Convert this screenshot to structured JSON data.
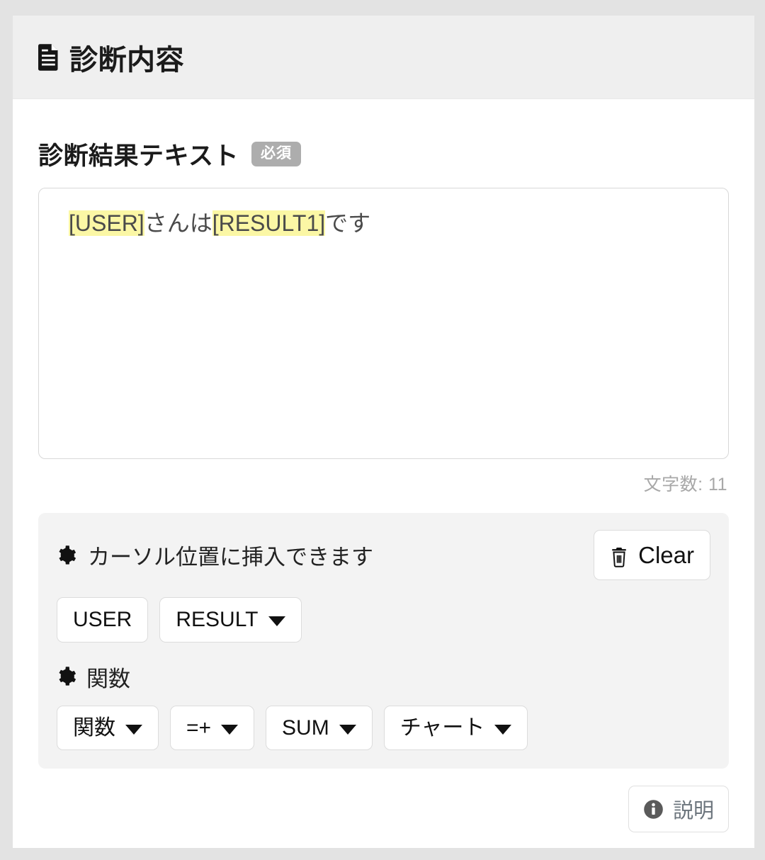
{
  "header": {
    "icon": "document-icon",
    "title": "診断内容"
  },
  "field": {
    "label": "診断結果テキスト",
    "required_badge": "必須",
    "textarea": {
      "segments": [
        {
          "text": "[USER]",
          "highlight": true
        },
        {
          "text": "さんは",
          "highlight": false
        },
        {
          "text": "[RESULT1]",
          "highlight": false
        },
        {
          "text": "です",
          "highlight": false
        }
      ],
      "value": "[USER]さんは[RESULT1]です",
      "token_1": "[USER]",
      "plain_1": "さんは",
      "token_2": "[RESULT1]",
      "plain_2": "です",
      "placeholder": ""
    },
    "char_count_label": "文字数: 11"
  },
  "insert_panel": {
    "gear_icon": "gear-icon",
    "heading": "カーソル位置に挿入できます",
    "clear_button": {
      "icon": "trash-icon",
      "label": "Clear"
    },
    "variable_buttons": [
      {
        "label": "USER",
        "has_caret": false
      },
      {
        "label": "RESULT",
        "has_caret": true
      }
    ],
    "function_section": {
      "gear_icon": "gear-icon",
      "heading": "関数",
      "buttons": [
        {
          "label": "関数",
          "has_caret": true
        },
        {
          "label": "=+",
          "has_caret": true
        },
        {
          "label": "SUM",
          "has_caret": true
        },
        {
          "label": "チャート",
          "has_caret": true
        }
      ]
    }
  },
  "footer": {
    "help_button": {
      "icon": "info-circle-icon",
      "label": "説明"
    }
  },
  "colors": {
    "page_background": "#e3e3e3",
    "card_background": "#ffffff",
    "header_band": "#efefef",
    "panel_background": "#f3f3f3",
    "highlight_yellow": "#fbf7a5",
    "badge_gray": "#adadad",
    "muted_text": "#a8a8a8",
    "help_text": "#6c757d"
  }
}
